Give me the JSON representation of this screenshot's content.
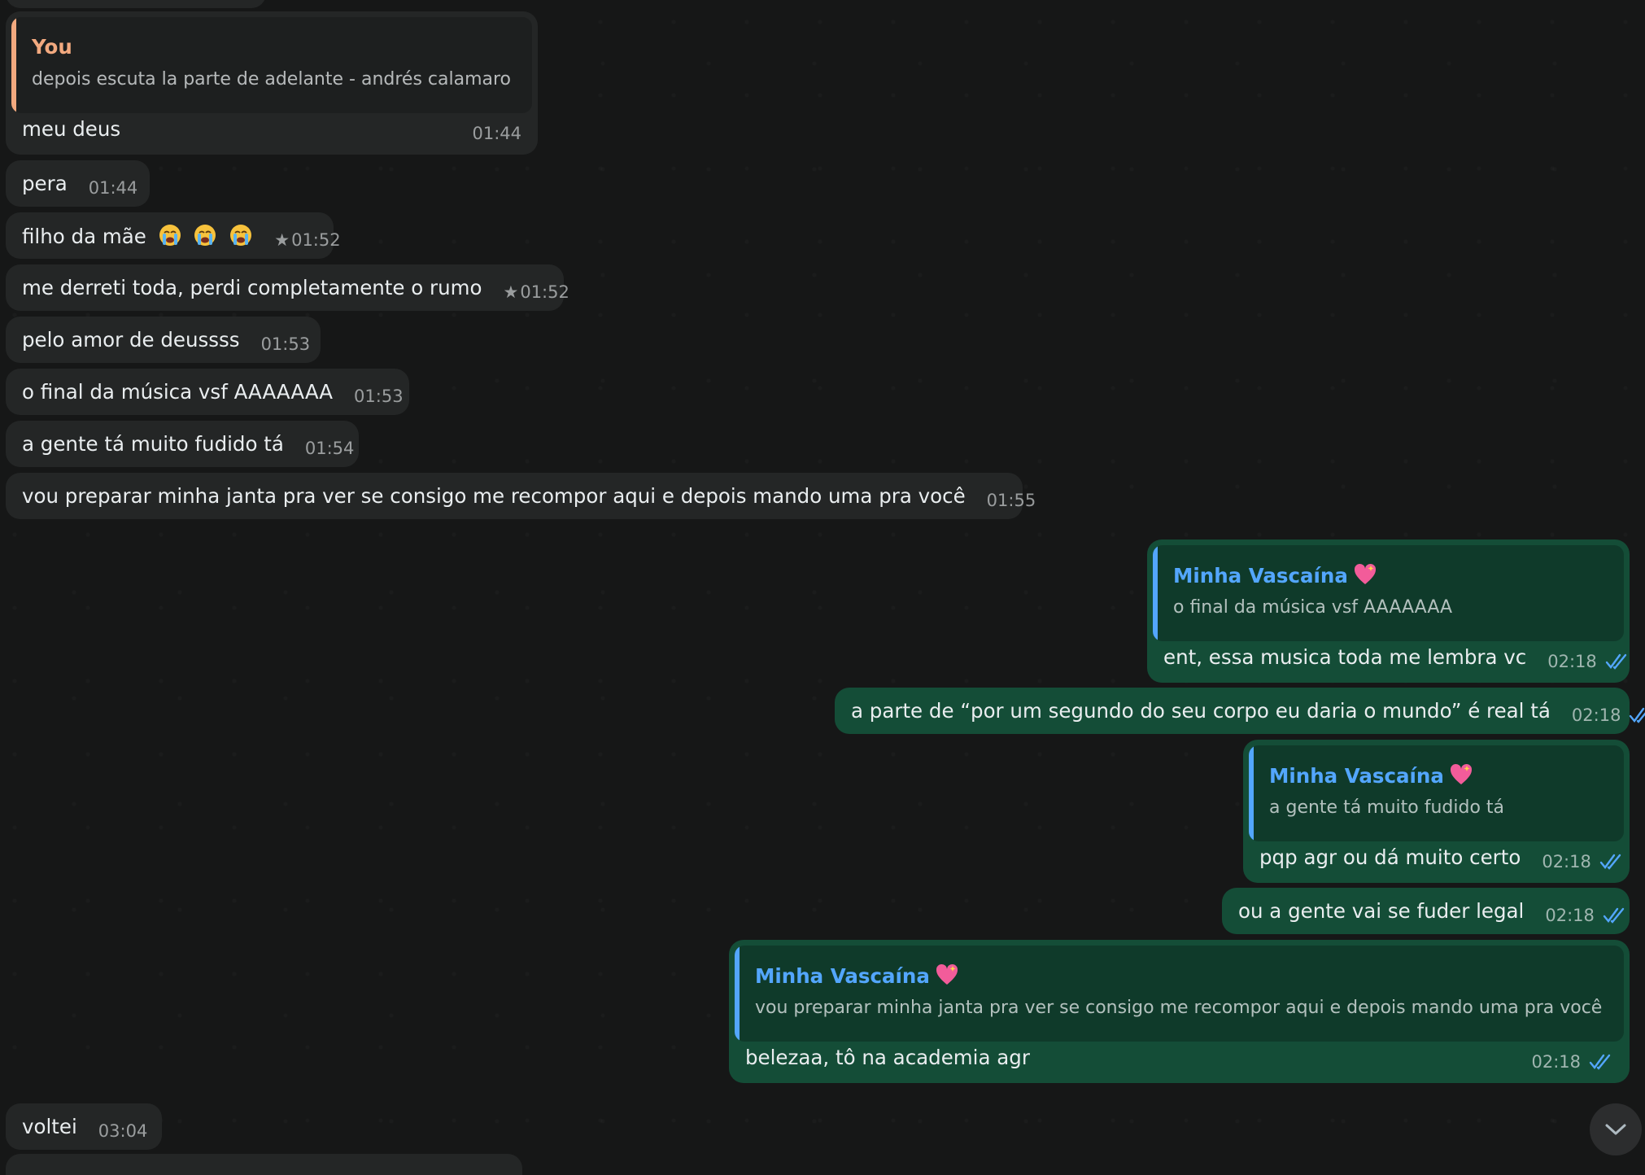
{
  "colors": {
    "background": "#161717",
    "incoming_bubble": "#242626",
    "outgoing_bubble": "#144d37",
    "you_accent": "#f2a97f",
    "contact_accent": "#53a6fd",
    "read_ticks": "#53a6fd"
  },
  "messages": [
    {
      "direction": "incoming",
      "quote": {
        "author": "You",
        "text": "depois escuta la parte de adelante - andrés calamaro"
      },
      "text": "meu deus",
      "time": "01:44"
    },
    {
      "direction": "incoming",
      "text": "pera",
      "time": "01:44"
    },
    {
      "direction": "incoming",
      "text": "filho da mãe",
      "emoji": [
        "loudly-crying-face",
        "loudly-crying-face",
        "loudly-crying-face"
      ],
      "starred": true,
      "time": "01:52"
    },
    {
      "direction": "incoming",
      "text": "me derreti toda, perdi completamente o rumo",
      "starred": true,
      "time": "01:52"
    },
    {
      "direction": "incoming",
      "text": "pelo amor de deussss",
      "time": "01:53"
    },
    {
      "direction": "incoming",
      "text": "o final da música vsf AAAAAAA",
      "time": "01:53"
    },
    {
      "direction": "incoming",
      "text": "a gente tá muito fudido tá",
      "time": "01:54"
    },
    {
      "direction": "incoming",
      "text": "vou preparar minha janta pra ver se consigo me recompor aqui e depois mando uma pra você",
      "time": "01:55"
    },
    {
      "direction": "outgoing",
      "quote": {
        "author": "Minha Vascaína",
        "author_emoji": "sparkling-heart",
        "text": "o final da música vsf AAAAAAA"
      },
      "text": "ent, essa musica toda me lembra vc",
      "time": "02:18",
      "status": "read"
    },
    {
      "direction": "outgoing",
      "text": "a parte de “por um segundo do seu corpo eu daria o mundo” é real tá",
      "time": "02:18",
      "status": "read"
    },
    {
      "direction": "outgoing",
      "quote": {
        "author": "Minha Vascaína",
        "author_emoji": "sparkling-heart",
        "text": "a gente tá muito fudido tá"
      },
      "text": "pqp agr ou dá muito certo",
      "time": "02:18",
      "status": "read"
    },
    {
      "direction": "outgoing",
      "text": "ou a gente vai se fuder legal",
      "time": "02:18",
      "status": "read"
    },
    {
      "direction": "outgoing",
      "quote": {
        "author": "Minha Vascaína",
        "author_emoji": "sparkling-heart",
        "text": "vou preparar minha janta pra ver se consigo me recompor aqui e depois mando uma pra você"
      },
      "text": "belezaa, tô na academia agr",
      "time": "02:18",
      "status": "read"
    },
    {
      "direction": "incoming",
      "text": "voltei",
      "time": "03:04"
    }
  ],
  "scroll_down_button": {
    "icon": "chevron-down-icon"
  }
}
